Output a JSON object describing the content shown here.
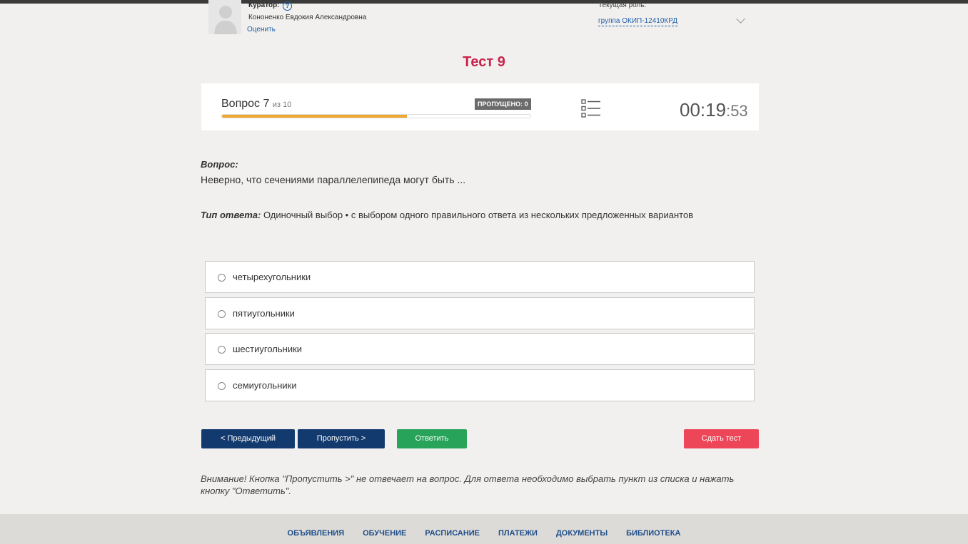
{
  "header": {
    "curator_label": "Куратор:",
    "help_symbol": "?",
    "curator_name": "Кононенко Евдокия Александровна",
    "rate_link": "Оценить",
    "role_label": "Текущая роль:",
    "role_value": "группа ОКИП-12410КРД"
  },
  "test": {
    "title": "Тест 9",
    "question_prefix": "Вопрос 7",
    "question_of": "из 10",
    "skipped_badge": "ПРОПУЩЕНО: 0",
    "progress_fraction": 0.6,
    "timer_main": "00:19",
    "timer_sec": ":53"
  },
  "question": {
    "heading": "Вопрос:",
    "text": "Неверно, что сечениями параллелепипеда могут быть ...",
    "answer_type_label": "Тип ответа:",
    "answer_type_value": " Одиночный выбор • с выбором одного правильного ответа из нескольких предложенных вариантов"
  },
  "options": [
    "четырехугольники",
    "пятиугольники",
    "шестиугольники",
    "семиугольники"
  ],
  "buttons": {
    "prev": "< Предыдущий",
    "skip": "Пропустить >",
    "answer": "Ответить",
    "submit": "Сдать тест"
  },
  "notice": "Внимание! Кнопка \"Пропустить >\" не отвечает на вопрос. Для ответа необходимо выбрать пункт из списка и нажать кнопку \"Ответить\".",
  "footer": {
    "nav": [
      "ОБЪЯВЛЕНИЯ",
      "ОБУЧЕНИЕ",
      "РАСПИСАНИЕ",
      "ПЛАТЕЖИ",
      "ДОКУМЕНТЫ",
      "БИБЛИОТЕКА"
    ]
  },
  "colors": {
    "title": "#c8234a",
    "progress": "#f0a830",
    "primary": "#123a6e",
    "success": "#28a35a",
    "danger": "#ee4659"
  }
}
